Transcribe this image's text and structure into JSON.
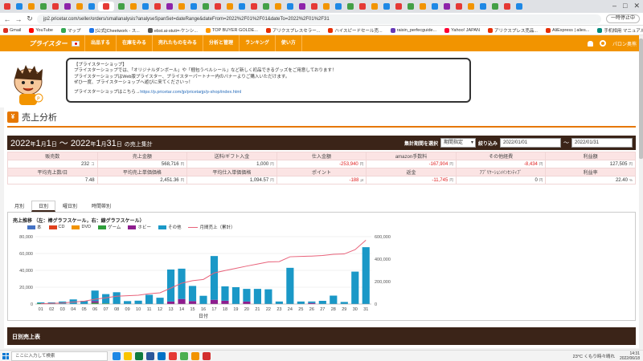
{
  "browser": {
    "url": "jp2.pricetar.com/seller/orders/smallanalysis?analyseSpanSet=dateRange&dateFrom=2022%2F01%2F01&dateTo=2022%2F01%2F31",
    "pause_label": "一時停止中",
    "bookmarks": [
      {
        "label": "Gmail",
        "color": "#d93025"
      },
      {
        "label": "YouTube",
        "color": "#ff0000"
      },
      {
        "label": "マップ",
        "color": "#34a853"
      },
      {
        "label": "[公式]Cheetwork - ス...",
        "color": "#1a73e8"
      },
      {
        "label": "ebst.ai-stuti=-ケンシ...",
        "color": "#555555"
      },
      {
        "label": "TOP BUYER GOLDE...",
        "color": "#ff9800"
      },
      {
        "label": "アリクスプレスセラー...",
        "color": "#e62e04"
      },
      {
        "label": "ハイスピードセール売...",
        "color": "#e62e04"
      },
      {
        "label": "raisin_perfecguide...",
        "color": "#673ab7"
      },
      {
        "label": "Yahoo! JAPAN",
        "color": "#ff0033"
      },
      {
        "label": "アリクスプレス売品...",
        "color": "#e62e04"
      },
      {
        "label": "AliExpress | alies...",
        "color": "#e62e04"
      },
      {
        "label": "手机相用 マニュアル",
        "color": "#00897b"
      },
      {
        "label": "https://shoppingcar...",
        "color": "#1a73e8"
      }
    ]
  },
  "header": {
    "logo": "プライスター",
    "nav": [
      "出品する",
      "在庫をみる",
      "売れたものをみる",
      "分析と管理",
      "ランキング",
      "使い方"
    ],
    "user_label": "パロン奥熊"
  },
  "bubble": {
    "title": "【プライスターショップ】",
    "line1": "プライスターショップでは、「オリジナルダンボール」や「梱包うベルシール」など新しく初品できるグッズをご用意しております！",
    "line2": "プライスターショップはWeb版プライスター、プライスターパートナー内のバナーよりご購入いただけます。",
    "line3": "ぜひ一度、プライスターショップへ遊びに来てくださいっ！",
    "link_prefix": "プライスターショップはこちら→",
    "link": "https://p.pricetar.com/jp/pricetarjp/p-shop/index.html"
  },
  "page": {
    "title": "売上分析",
    "icon": "¥",
    "range_year1": "2022",
    "range_month1": "1",
    "range_day1": "1",
    "range_year2": "2022",
    "range_month2": "1",
    "range_day2": "31",
    "unit_year": "年",
    "unit_month": "月",
    "unit_day": "日",
    "range_sep": "～",
    "range_suffix": "の売上集計",
    "period_label": "集計期間を選択",
    "period_value": "期間指定",
    "filter_label": "絞り込み",
    "date_from": "2022/01/01",
    "date_to": "2022/01/31",
    "date_sep": "～"
  },
  "stats": {
    "row1_headers": [
      "販売数",
      "売上金額",
      "送料/ギフト入金",
      "仕入金額",
      "amazon手数料",
      "その他経費",
      "利益額"
    ],
    "row1_values": [
      {
        "v": "232",
        "u": "コ",
        "neg": false
      },
      {
        "v": "568,716",
        "u": "円",
        "neg": false
      },
      {
        "v": "1,000",
        "u": "円",
        "neg": false
      },
      {
        "v": "-253,940",
        "u": "円",
        "neg": true
      },
      {
        "v": "-167,904",
        "u": "円",
        "neg": true
      },
      {
        "v": "-8,434",
        "u": "円",
        "neg": true
      },
      {
        "v": "127,505",
        "u": "円",
        "neg": false
      }
    ],
    "row2_headers": [
      "平均売上数/日",
      "平均売上単価価格",
      "平均仕入単価価格",
      "ポイント",
      "返金",
      "ｱﾌﾞﾘｹｰｼｮﾝ/ｲﾝｾﾝﾃｨﾌﾞ",
      "利益率"
    ],
    "row2_values": [
      {
        "v": "7.48",
        "u": "",
        "neg": false
      },
      {
        "v": "2,451.36",
        "u": "円",
        "neg": false
      },
      {
        "v": "1,094.57",
        "u": "円",
        "neg": false
      },
      {
        "v": "-188",
        "u": "pt",
        "neg": true
      },
      {
        "v": "-11,745",
        "u": "円",
        "neg": true
      },
      {
        "v": "0",
        "u": "円",
        "neg": false
      },
      {
        "v": "22.40",
        "u": "%",
        "neg": false
      }
    ]
  },
  "chart_tabs": [
    "月別",
    "日別",
    "曜日別",
    "時間帯別"
  ],
  "chart_active_tab": 1,
  "chart_data": {
    "type": "bar",
    "title": "売上推移 （左：棒グラフスケール，右：線グラフスケール）",
    "xlabel": "日付",
    "categories": [
      "01",
      "02",
      "03",
      "04",
      "05",
      "06",
      "07",
      "08",
      "09",
      "10",
      "11",
      "12",
      "13",
      "14",
      "15",
      "16",
      "17",
      "18",
      "19",
      "20",
      "21",
      "22",
      "23",
      "24",
      "25",
      "26",
      "27",
      "28",
      "29",
      "30",
      "31"
    ],
    "ylim": [
      0,
      80000
    ],
    "y2lim": [
      0,
      600000
    ],
    "yticks": [
      "0",
      "20,000",
      "40,000",
      "60,000",
      "80,000"
    ],
    "y2ticks": [
      "0",
      "200,000",
      "400,000",
      "600,000"
    ],
    "stacked": true,
    "series": [
      {
        "name": "本",
        "color": "#4472c4",
        "values": [
          0,
          0,
          0,
          0,
          0,
          0,
          0,
          0,
          0,
          0,
          0,
          0,
          0,
          0,
          0,
          0,
          0,
          0,
          0,
          0,
          0,
          0,
          0,
          0,
          0,
          0,
          0,
          0,
          0,
          0,
          0
        ]
      },
      {
        "name": "CD",
        "color": "#e0401c",
        "values": [
          0,
          0,
          0,
          0,
          0,
          0,
          0,
          0,
          0,
          0,
          0,
          0,
          0,
          0,
          0,
          0,
          0,
          0,
          0,
          0,
          0,
          0,
          0,
          0,
          0,
          0,
          0,
          0,
          0,
          0,
          0
        ]
      },
      {
        "name": "DVD",
        "color": "#f29400",
        "values": [
          0,
          0,
          0,
          0,
          0,
          0,
          0,
          0,
          0,
          0,
          0,
          0,
          0,
          0,
          0,
          0,
          0,
          0,
          0,
          0,
          0,
          0,
          0,
          0,
          0,
          0,
          0,
          0,
          0,
          0,
          0
        ]
      },
      {
        "name": "ゲーム",
        "color": "#2e9e3a",
        "values": [
          1000,
          0,
          0,
          0,
          0,
          1500,
          800,
          0,
          0,
          0,
          0,
          0,
          0,
          0,
          0,
          0,
          0,
          0,
          0,
          0,
          0,
          0,
          0,
          0,
          0,
          0,
          0,
          0,
          0,
          0,
          0
        ]
      },
      {
        "name": "ホビー",
        "color": "#8e1c8e",
        "values": [
          0,
          0,
          0,
          0,
          0,
          2000,
          0,
          0,
          0,
          0,
          0,
          0,
          3000,
          6000,
          3500,
          0,
          5000,
          4000,
          0,
          3000,
          0,
          0,
          0,
          0,
          0,
          1200,
          0,
          0,
          0,
          0,
          0
        ]
      },
      {
        "name": "その他",
        "color": "#1a98c7",
        "values": [
          1000,
          2000,
          3000,
          5500,
          3800,
          12500,
          11000,
          14000,
          3500,
          4000,
          11000,
          7500,
          38000,
          36000,
          18000,
          9800,
          52000,
          17000,
          20000,
          15000,
          18000,
          17500,
          3000,
          43000,
          3000,
          1800,
          3800,
          10000,
          2500,
          38500,
          67500
        ]
      }
    ],
    "line_series": {
      "name": "月間売上（累計）",
      "color": "#e8627a",
      "values": [
        3000,
        6000,
        9000,
        18000,
        25000,
        43000,
        55000,
        70000,
        74000,
        79000,
        92000,
        100000,
        142000,
        186000,
        208000,
        219000,
        277000,
        298000,
        318000,
        338000,
        356000,
        375000,
        378000,
        421000,
        424000,
        427000,
        432000,
        443000,
        446000,
        484000,
        569000
      ]
    }
  },
  "daily_table": {
    "title": "日別売上表"
  },
  "taskbar": {
    "search_placeholder": "ここに入力して検索",
    "weather": "23°C くもり時々晴れ",
    "time": "14:31",
    "date": "2022/06/18"
  }
}
